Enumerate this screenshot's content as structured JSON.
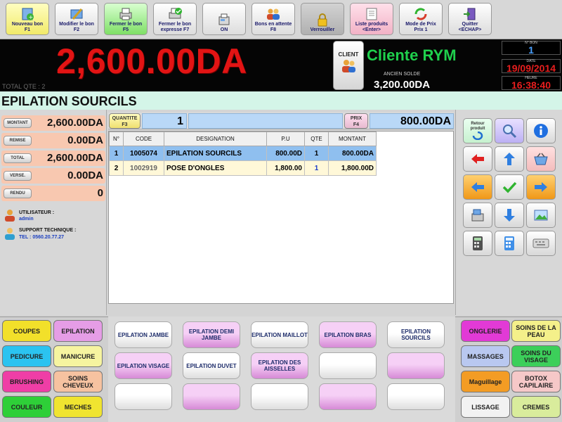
{
  "toolbar": {
    "buttons": [
      {
        "label": "Nouveau bon",
        "key": "F1"
      },
      {
        "label": "Modifier le bon",
        "key": "F2"
      },
      {
        "label": "Fermer le bon",
        "key": "F5"
      },
      {
        "label": "Fermer le bon expresse F7",
        "key": ""
      },
      {
        "label": "ON",
        "key": ""
      },
      {
        "label": "Bons en attente F8",
        "key": ""
      },
      {
        "label": "Verrouiller",
        "key": ""
      },
      {
        "label": "Liste produits",
        "key": "<Enter>"
      },
      {
        "label": "Mode de Prix",
        "key": "Prix 1"
      },
      {
        "label": "Quitter",
        "key": "<ECHAP>"
      }
    ]
  },
  "header": {
    "total_amount": "2,600.00DA",
    "total_qte": "TOTAL QTE : 2",
    "client_label": "CLIENT",
    "client_name": "Cliente RYM",
    "old_sold_label": "ANCIEN SOLDE",
    "old_sold_value": "3,200.00DA",
    "bon_caption": "N° BON",
    "bon_number": "1",
    "date_caption": "DATE",
    "date": "19/09/2014",
    "time_caption": "HEURE",
    "time": "16:38:40"
  },
  "product_title": "EPILATION SOURCILS",
  "summary": [
    {
      "label": "MONTANT",
      "value": "2,600.00DA"
    },
    {
      "label": "REMISE",
      "value": "0.00DA"
    },
    {
      "label": "TOTAL",
      "value": "2,600.00DA"
    },
    {
      "label": "VERSE.",
      "value": "0.00DA"
    },
    {
      "label": "RENDU",
      "value": "0"
    }
  ],
  "user": {
    "user_label": "UTILISATEUR :",
    "user_name": "admin",
    "support_label": "SUPPORT TECHNIQUE :",
    "support_tel": "TEL : 0560.20.77.27"
  },
  "qty": {
    "qty_label_1": "QUANTITE",
    "qty_label_2": "F3",
    "qty_value": "1",
    "price_label_1": "PRIX",
    "price_label_2": "F4",
    "price_value": "800.00DA"
  },
  "table": {
    "headers": [
      "N°",
      "CODE",
      "DESIGNATION",
      "P.U",
      "QTE",
      "MONTANT"
    ],
    "rows": [
      [
        "1",
        "1005074",
        "EPILATION SOURCILS",
        "800.00D",
        "1",
        "800.00DA"
      ],
      [
        "2",
        "1002919",
        "POSE D'ONGLES",
        "1,800.00",
        "1",
        "1,800.00D"
      ]
    ]
  },
  "keypad": {
    "retour_label_1": "Retour",
    "retour_label_2": "produit"
  },
  "categories_left": [
    {
      "label": "COUPES",
      "color": "#f2e02a"
    },
    {
      "label": "EPILATION",
      "color": "#e59de6"
    },
    {
      "label": "PEDICURE",
      "color": "#2bc3f0"
    },
    {
      "label": "MANICURE",
      "color": "#f6f4a0"
    },
    {
      "label": "BRUSHING",
      "color": "#ef3ea6"
    },
    {
      "label": "SOINS CHEVEUX",
      "color": "#f6c2a0"
    },
    {
      "label": "COULEUR",
      "color": "#2ecf38"
    },
    {
      "label": "MECHES",
      "color": "#f0e430"
    }
  ],
  "services": [
    {
      "label": "EPILATION JAMBE",
      "style": "w"
    },
    {
      "label": "EPILATION DEMI JAMBE",
      "style": "p"
    },
    {
      "label": "EPILATION MAILLOT",
      "style": "w"
    },
    {
      "label": "EPILATION BRAS",
      "style": "p"
    },
    {
      "label": "EPILATION SOURCILS",
      "style": "w"
    },
    {
      "label": "EPILATION VISAGE",
      "style": "p"
    },
    {
      "label": "EPILATION DUVET",
      "style": "w"
    },
    {
      "label": "EPILATION DES AISSELLES",
      "style": "p"
    },
    {
      "label": "",
      "style": "w"
    },
    {
      "label": "",
      "style": "p"
    },
    {
      "label": "",
      "style": "w"
    },
    {
      "label": "",
      "style": "p"
    },
    {
      "label": "",
      "style": "w"
    },
    {
      "label": "",
      "style": "p"
    },
    {
      "label": "",
      "style": "w"
    }
  ],
  "categories_right": [
    {
      "label": "ONGLERIE",
      "color": "#e23ad6"
    },
    {
      "label": "SOINS DE LA PEAU",
      "color": "#f4f08a"
    },
    {
      "label": "MASSAGES",
      "color": "#b9c8f0"
    },
    {
      "label": "SOINS DU VISAGE",
      "color": "#3ccf5a"
    },
    {
      "label": "Maguillage",
      "color": "#f39c24"
    },
    {
      "label": "BOTOX CAPILAIRE",
      "color": "#f6c8c8"
    },
    {
      "label": "LISSAGE",
      "color": "#f2f2f2"
    },
    {
      "label": "CREMES",
      "color": "#d9ec9c"
    }
  ]
}
